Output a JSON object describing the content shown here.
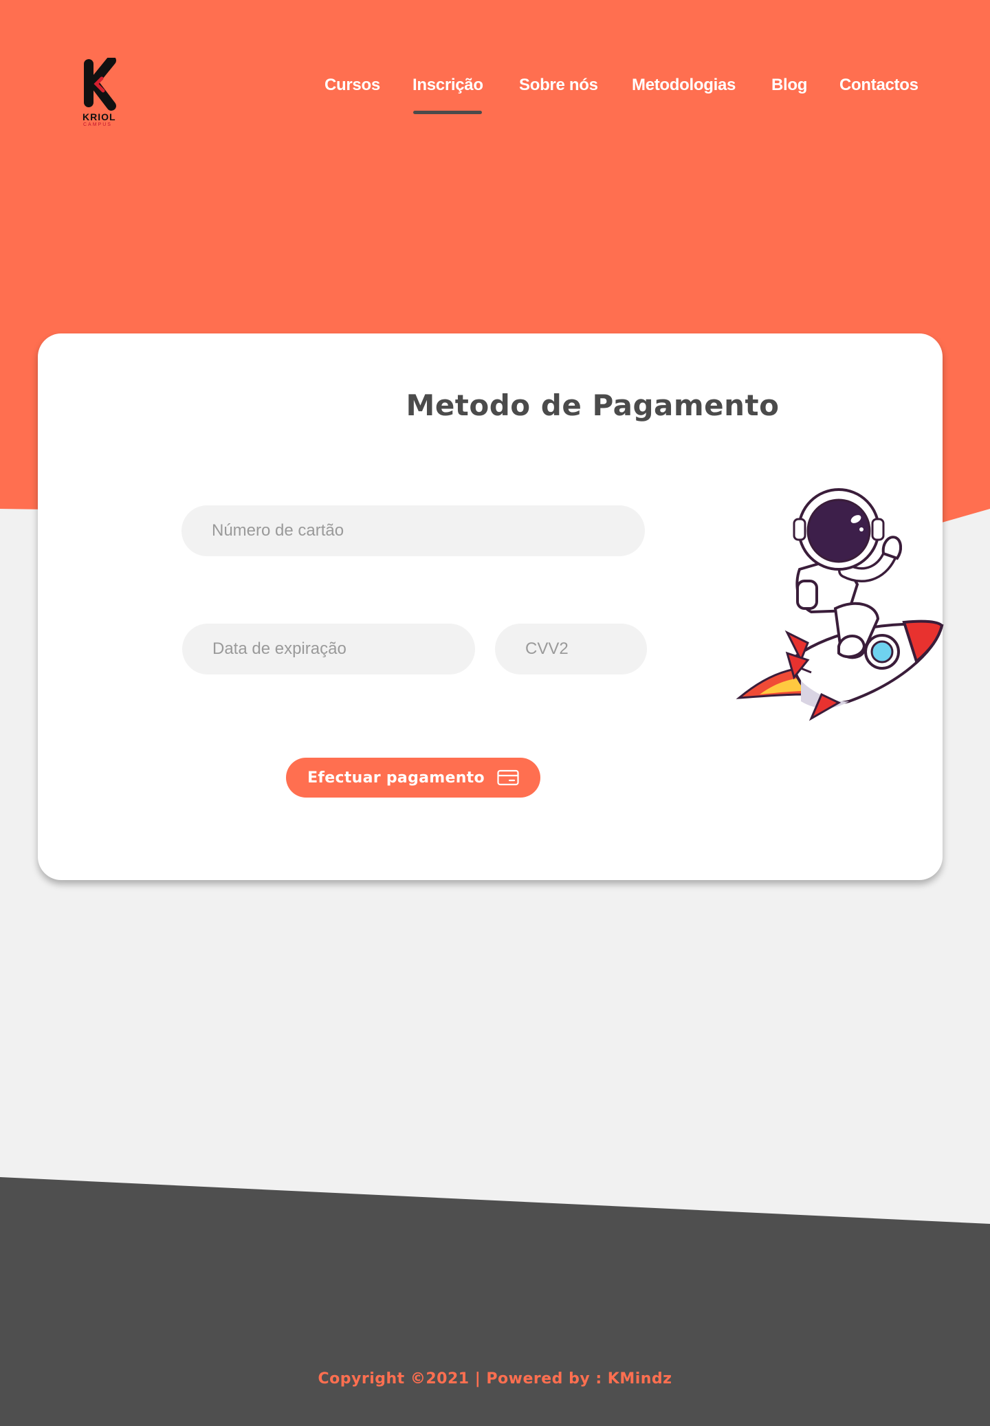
{
  "brand": {
    "name": "KRIOL",
    "sub": "CAMPUS",
    "accent_color": "#ff6f50",
    "dark_color": "#4b4b4b"
  },
  "nav": {
    "items": [
      {
        "label": "Cursos"
      },
      {
        "label": "Inscrição",
        "active": true
      },
      {
        "label": "Sobre nós"
      },
      {
        "label": "Metodologias"
      },
      {
        "label": "Blog"
      },
      {
        "label": "Contactos"
      }
    ]
  },
  "payment": {
    "title": "Metodo de Pagamento",
    "card_number": {
      "value": "",
      "placeholder": "Número de cartão"
    },
    "expiry": {
      "value": "",
      "placeholder": "Data de expiração"
    },
    "cvv": {
      "value": "",
      "placeholder": "CVV2"
    },
    "submit_label": "Efectuar pagamento",
    "submit_icon": "credit-card-icon"
  },
  "illustration": {
    "icon": "astronaut-rocket-illustration"
  },
  "footer": {
    "copyright": "Copyright ©2021 | Powered by : KMindz"
  }
}
